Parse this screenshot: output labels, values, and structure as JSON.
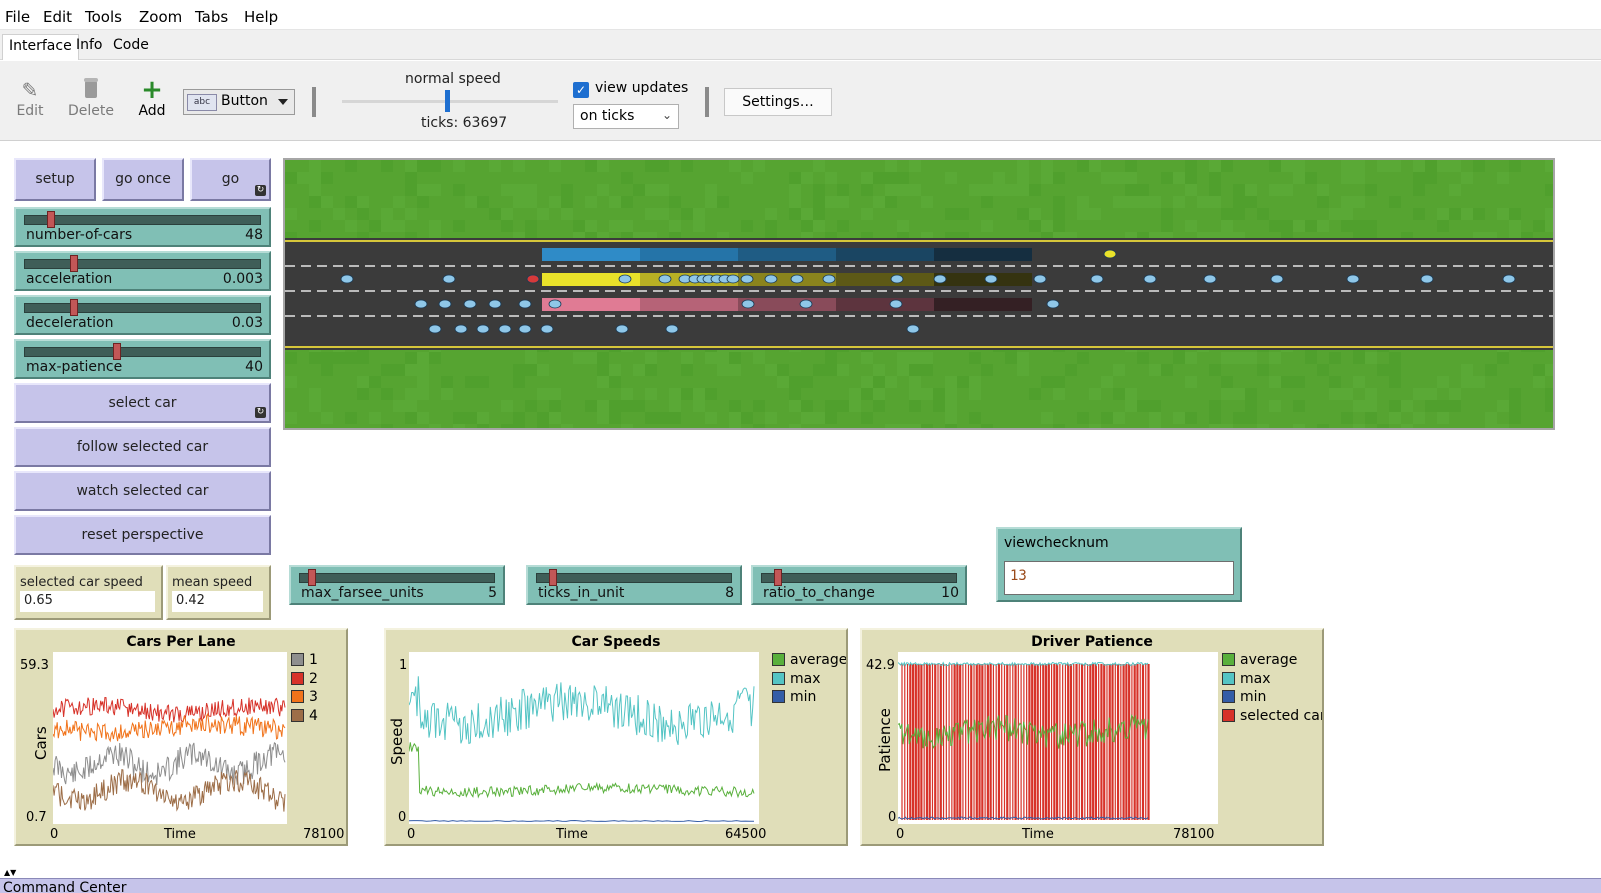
{
  "menu": [
    "File",
    "Edit",
    "Tools",
    "Zoom",
    "Tabs",
    "Help"
  ],
  "tabs": [
    "Interface",
    "Info",
    "Code"
  ],
  "toolbar": {
    "edit_label": "Edit",
    "delete_label": "Delete",
    "add_label": "Add",
    "widget_type": "Button",
    "widget_icon_text": "abc",
    "speed_label": "normal speed",
    "speed_level": 0.5,
    "ticks_label": "ticks: 63697",
    "view_updates_label": "view updates",
    "view_updates_checked": true,
    "update_mode": "on ticks",
    "settings_label": "Settings…"
  },
  "buttons": {
    "setup": "setup",
    "go_once": "go once",
    "go": "go",
    "select_car": "select car",
    "follow_selected_car": "follow selected car",
    "watch_selected_car": "watch selected car",
    "reset_perspective": "reset perspective"
  },
  "sliders": {
    "number_of_cars": {
      "name": "number-of-cars",
      "value": "48",
      "level": 0.1
    },
    "acceleration": {
      "name": "acceleration",
      "value": "0.003",
      "level": 0.2
    },
    "deceleration": {
      "name": "deceleration",
      "value": "0.03",
      "level": 0.2
    },
    "max_patience": {
      "name": "max-patience",
      "value": "40",
      "level": 0.39
    },
    "max_farsee_units": {
      "name": "max_farsee_units",
      "value": "5",
      "level": 0.05
    },
    "ticks_in_unit": {
      "name": "ticks_in_unit",
      "value": "8",
      "level": 0.07
    },
    "ratio_to_change": {
      "name": "ratio_to_change",
      "value": "10",
      "level": 0.07
    }
  },
  "monitors": {
    "selected_car_speed": {
      "label": "selected car speed",
      "value": "0.65"
    },
    "mean_speed": {
      "label": "mean speed",
      "value": "0.42"
    }
  },
  "input": {
    "label": "viewchecknum",
    "value": "13"
  },
  "colors": {
    "button_bg": "#c6c4ea",
    "slider_bg": "#80bfb5",
    "monitor_bg": "#e0deb9",
    "grass": "#57a432",
    "road": "#3a3a3a",
    "speed_blue": "#1e6fd0"
  },
  "plots": [
    {
      "title": "Cars Per Lane",
      "ylabel": "Cars",
      "xlabel": "Time",
      "ymax_label": "59.3",
      "ymin_label": "0.7",
      "xmin_label": "0",
      "xmax_label": "78100",
      "legend": [
        {
          "name": "1",
          "color": "#8e8e8e"
        },
        {
          "name": "2",
          "color": "#d73229"
        },
        {
          "name": "3",
          "color": "#f1731a"
        },
        {
          "name": "4",
          "color": "#9d6e48"
        }
      ]
    },
    {
      "title": "Car Speeds",
      "ylabel": "Speed",
      "xlabel": "Time",
      "ymax_label": "1",
      "ymin_label": "0",
      "xmin_label": "0",
      "xmax_label": "64500",
      "legend": [
        {
          "name": "average",
          "color": "#59b03c"
        },
        {
          "name": "max",
          "color": "#54c4c4"
        },
        {
          "name": "min",
          "color": "#345da7"
        }
      ]
    },
    {
      "title": "Driver Patience",
      "ylabel": "Patience",
      "xlabel": "Time",
      "ymax_label": "42.9",
      "ymin_label": "0",
      "xmin_label": "0",
      "xmax_label": "78100",
      "legend": [
        {
          "name": "average",
          "color": "#59b03c"
        },
        {
          "name": "max",
          "color": "#54c4c4"
        },
        {
          "name": "min",
          "color": "#345da7"
        },
        {
          "name": "selected car",
          "color": "#d73229"
        }
      ]
    }
  ],
  "command_center": "Command Center"
}
